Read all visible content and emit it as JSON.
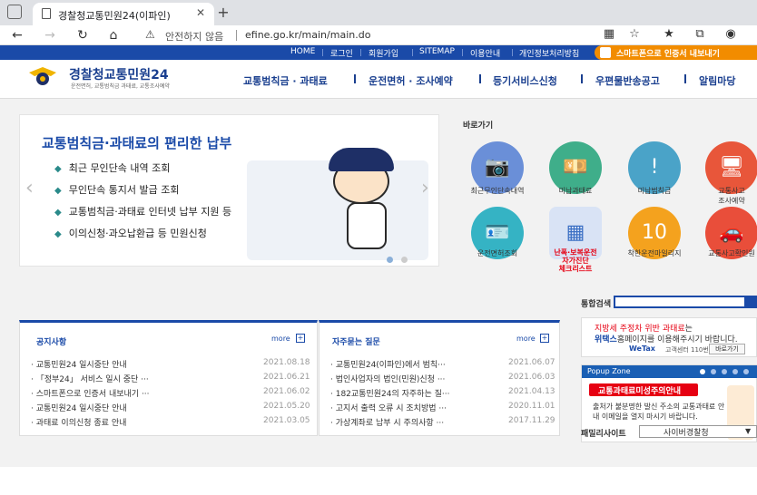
{
  "browser": {
    "tab_title": "경찰청교통민원24(이파인)",
    "tab_close": "✕",
    "new_tab": "+",
    "address_status": "안전하지 않음",
    "address_url": "efine.go.kr/main/main.do"
  },
  "topbar": {
    "links": [
      "HOME",
      "로그인",
      "회원가입",
      "SITEMAP",
      "이용안내",
      "개인정보처리방침"
    ],
    "smart_cert": "스마트폰으로 인증서 내보내기"
  },
  "header": {
    "logo_title_1": "경찰청",
    "logo_title_2": "교통민원24",
    "logo_subtitle": "운전면허, 교통범칙금 과태료, 교통조사예약",
    "menu": [
      "교통범칙금 · 과태료",
      "운전면허 · 조사예약",
      "등기서비스신청",
      "우편물반송공고",
      "알림마당"
    ]
  },
  "banner": {
    "title": "교통범칙금·과태료의 편리한 납부",
    "items": [
      "최근 무인단속 내역 조회",
      "무인단속 통지서 발급 조회",
      "교통범칙금·과태료 인터넷 납부 지원 등",
      "이의신청·과오납환급 등 민원신청"
    ]
  },
  "quicklinks": {
    "title": "바로가기",
    "items": [
      {
        "label": "최근무인단속내역",
        "color": "#6a8fd8",
        "icon": "camera-icon",
        "glyph": "📷"
      },
      {
        "label": "미납과태료",
        "color": "#3fae8a",
        "icon": "money-icon",
        "glyph": "💴"
      },
      {
        "label": "미납범칙금",
        "color": "#4aa3c8",
        "icon": "warning-icon",
        "glyph": "!"
      },
      {
        "label": "교통사고\n조사예약",
        "color": "#e8563a",
        "icon": "monitor-icon",
        "glyph": "🖥"
      },
      {
        "label": "운전면허조회",
        "color": "#35b3c4",
        "icon": "license-card-icon",
        "glyph": "🪪"
      },
      {
        "label": "난폭·보복운전\n자가진단\n체크리스트",
        "color": "#d9e3f5",
        "icon": "checklist-icon",
        "glyph": "▦",
        "red": true
      },
      {
        "label": "착한운전마일리지",
        "color": "#f4a21e",
        "icon": "mileage-truck-icon",
        "glyph": "10"
      },
      {
        "label": "교통사고확인원",
        "color": "#e94e3a",
        "icon": "car-crash-icon",
        "glyph": "🚗"
      }
    ]
  },
  "search": {
    "label": "통합검색"
  },
  "notice": {
    "title": "공지사항",
    "more": "more",
    "plus": "+",
    "rows": [
      {
        "text": "교통민원24 일시중단 안내",
        "date": "2021.08.18"
      },
      {
        "text": "「정부24」 서비스 일시 중단 ···",
        "date": "2021.06.21"
      },
      {
        "text": "스마트폰으로 인증서 내보내기 ···",
        "date": "2021.06.02"
      },
      {
        "text": "교통민원24 일시중단 안내",
        "date": "2021.05.20"
      },
      {
        "text": "과태료 이의신청 종료 안내",
        "date": "2021.03.05"
      }
    ]
  },
  "faq": {
    "title": "자주묻는 질문",
    "more": "more",
    "plus": "+",
    "rows": [
      {
        "text": "교통민원24(이파인)에서 범칙···",
        "date": "2021.06.07"
      },
      {
        "text": "법인사업자의 법인(민원)신청 ···",
        "date": "2021.06.03"
      },
      {
        "text": "182교통민원24의 자주하는 질···",
        "date": "2021.04.13"
      },
      {
        "text": "고지서 출력 오류 시 조치방법 ···",
        "date": "2020.11.01"
      },
      {
        "text": "가상계좌로 납부 시 주의사항 ···",
        "date": "2017.11.29"
      }
    ]
  },
  "wetax": {
    "line1_a": "지방세 주정차 위반 과태료",
    "line1_b": "는",
    "line2_a": "위택스",
    "line2_b": "홈페이지를 이용해주시기 바랍니다.",
    "logo": "WeTax",
    "center": "고객센터 110번",
    "button": "바로가기"
  },
  "popup": {
    "title": "Popup Zone",
    "badge": "교통과태료미성주의안내",
    "body": "출처가 불분명한 발신 주소의 교통과태료 안내 이메일을 열지 마시기 바랍니다."
  },
  "family": {
    "label": "패밀리사이트",
    "selected": "사이버경찰청",
    "caret": "▼"
  },
  "colors": {
    "brand_blue": "#1a4aa8",
    "accent_orange": "#f28c00",
    "alert_red": "#e60012"
  }
}
